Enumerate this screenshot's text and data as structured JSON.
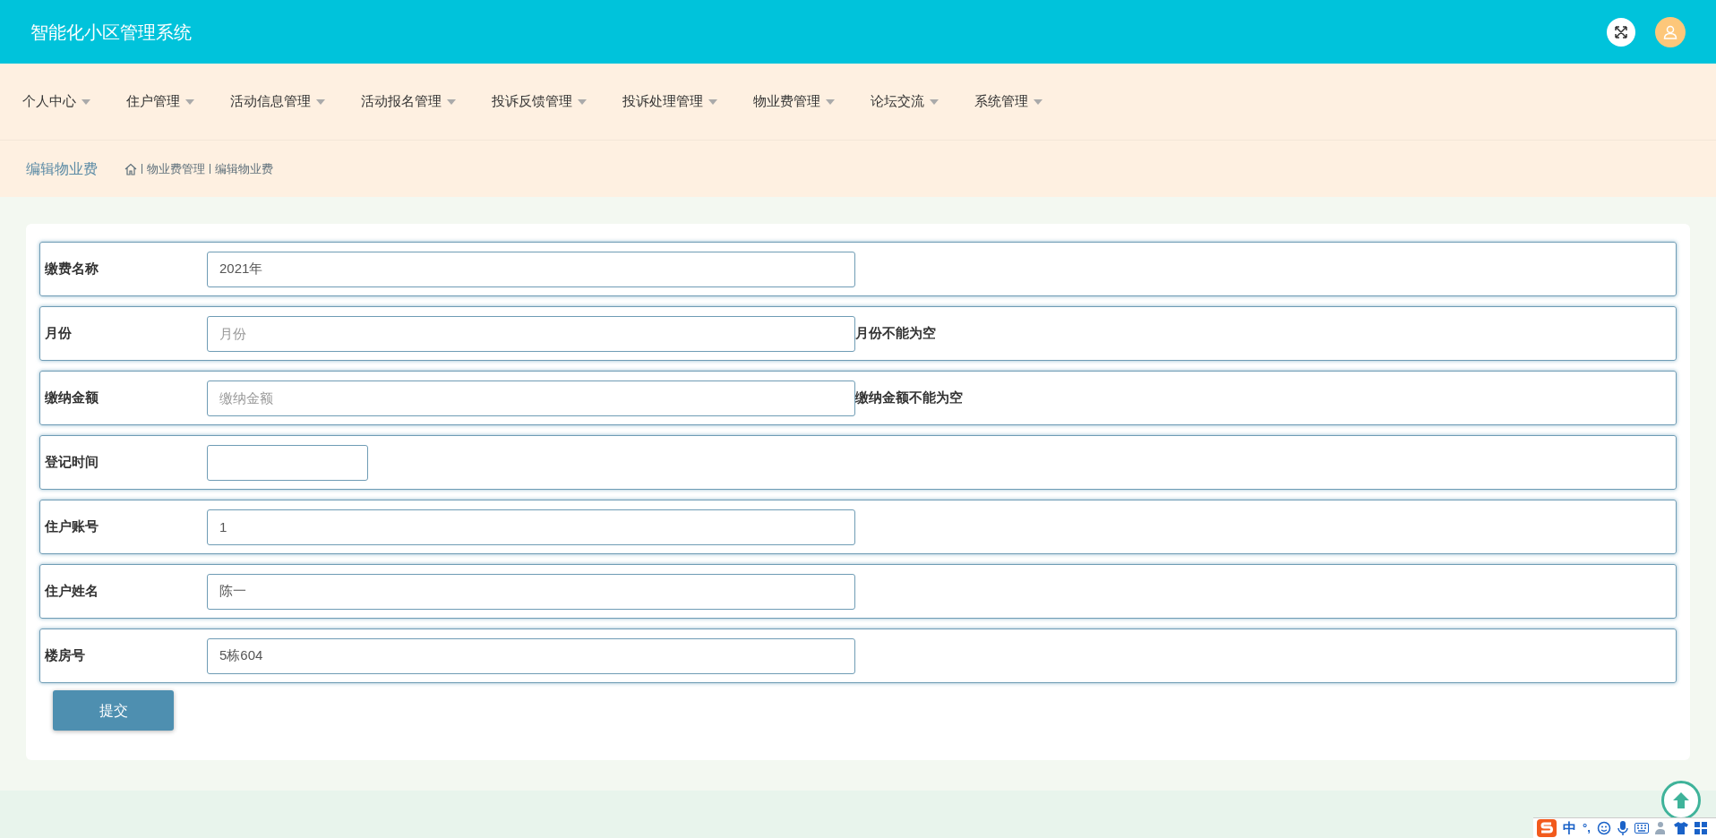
{
  "header": {
    "title": "智能化小区管理系统"
  },
  "nav": [
    {
      "label": "个人中心"
    },
    {
      "label": "住户管理"
    },
    {
      "label": "活动信息管理"
    },
    {
      "label": "活动报名管理"
    },
    {
      "label": "投诉反馈管理"
    },
    {
      "label": "投诉处理管理"
    },
    {
      "label": "物业费管理"
    },
    {
      "label": "论坛交流"
    },
    {
      "label": "系统管理"
    }
  ],
  "page_title": "编辑物业费",
  "breadcrumb": [
    "物业费管理",
    "编辑物业费"
  ],
  "form": {
    "fields": [
      {
        "kind": "text",
        "label": "缴费名称",
        "value": "2021年"
      },
      {
        "kind": "text",
        "label": "月份",
        "placeholder": "月份",
        "error": "月份不能为空"
      },
      {
        "kind": "text",
        "label": "缴纳金额",
        "placeholder": "缴纳金额",
        "error": "缴纳金额不能为空"
      },
      {
        "kind": "date",
        "label": "登记时间"
      },
      {
        "kind": "text",
        "label": "住户账号",
        "value": "1"
      },
      {
        "kind": "text",
        "label": "住户姓名",
        "value": "陈一"
      },
      {
        "kind": "text",
        "label": "楼房号",
        "value": "5栋604"
      }
    ],
    "submit": "提交"
  },
  "ime_bar": {
    "mode": "中",
    "punctuation": "°,"
  }
}
